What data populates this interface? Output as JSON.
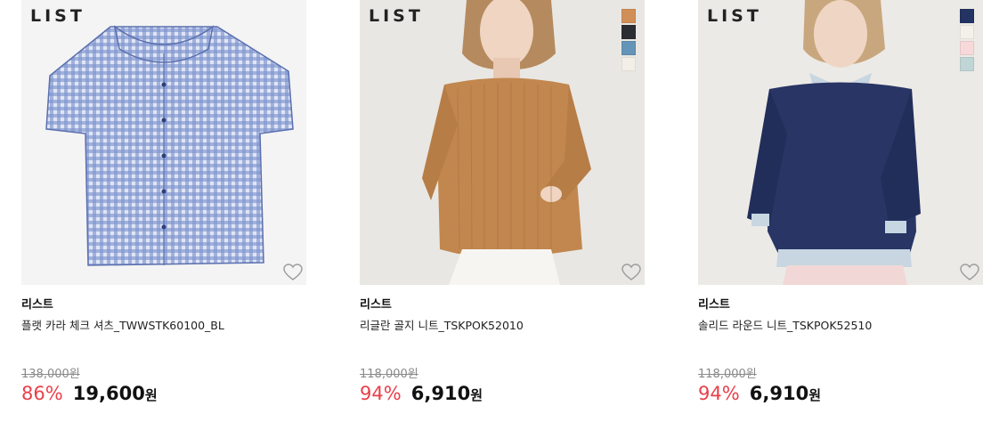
{
  "products": [
    {
      "logo": "LIST",
      "swatches": [],
      "brand": "리스트",
      "name": "플랫 카라 체크 셔츠_TWWSTK60100_BL",
      "original_price": "138,000원",
      "discount": "86%",
      "price": "19,600",
      "currency": "원",
      "icons": {
        "wishlist": "heart-outline-icon"
      }
    },
    {
      "logo": "LIST",
      "swatches": [
        "#d18f58",
        "#2a2d31",
        "#6494b8",
        "#f3efe7"
      ],
      "brand": "리스트",
      "name": "리글란 골지 니트_TSKPOK52010",
      "original_price": "118,000원",
      "discount": "94%",
      "price": "6,910",
      "currency": "원",
      "icons": {
        "wishlist": "heart-outline-icon"
      }
    },
    {
      "logo": "LIST",
      "swatches": [
        "#233463",
        "#f4f1e8",
        "#f6d9d8",
        "#bfd5d6"
      ],
      "brand": "리스트",
      "name": "솔리드 라운드 니트_TSKPOK52510",
      "original_price": "118,000원",
      "discount": "94%",
      "price": "6,910",
      "currency": "원",
      "icons": {
        "wishlist": "heart-outline-icon"
      }
    }
  ],
  "colors": {
    "discount": "#e8404a",
    "strikethrough": "#8a8a8a"
  }
}
